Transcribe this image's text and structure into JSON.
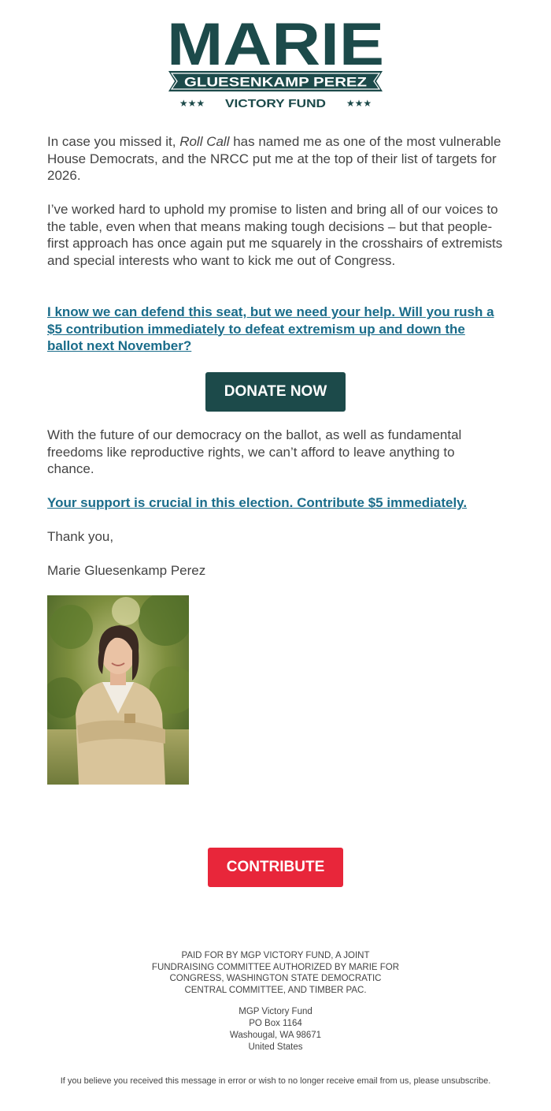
{
  "header": {
    "logo_name": "MARIE",
    "logo_surname": "GLUESENKAMP PEREZ",
    "logo_fund": "VICTORY FUND",
    "logo_stars": "★★★",
    "brand_color": "#1c4a4a"
  },
  "body": {
    "para1_prefix": "In case you missed it, ",
    "para1_italic": "Roll Call",
    "para1_suffix": " has named me as one of the most vulnerable House Democrats, and the NRCC put me at the top of their list of targets for 2026.",
    "para2": "I’ve worked hard to uphold my promise to listen and bring all of our voices to the table, even when that means making tough decisions – but that people-first approach has once again put me squarely in the crosshairs of extremists and special interests who want to kick me out of Congress.",
    "cta_link1": "I know we can defend this seat, but we need your help. Will you rush a $5 contribution immediately to defeat extremism up and down the ballot next November?",
    "donate_button": "DONATE NOW",
    "para3": "With the future of our democracy on the ballot, as well as fundamental freedoms like reproductive rights, we can’t afford to leave anything to chance.",
    "cta_link2": "Your support is crucial in this election. Contribute $5 immediately.",
    "thanks": "Thank you,",
    "signature": "Marie Gluesenkamp Perez",
    "contribute_button": "CONTRIBUTE",
    "link_color": "#1a6c8a",
    "contribute_color": "#e8263a"
  },
  "footer": {
    "disclaimer": "PAID FOR BY MGP VICTORY FUND, A JOINT FUNDRAISING COMMITTEE AUTHORIZED BY MARIE FOR CONGRESS, WASHINGTON STATE DEMOCRATIC CENTRAL COMMITTEE, AND TIMBER PAC.",
    "address_name": "MGP Victory Fund",
    "address_line1": "PO Box 1164",
    "address_line2": "Washougal, WA 98671",
    "address_country": "United States",
    "unsubscribe_text": "If you believe you received this message in error or wish to no longer receive email from us, please unsubscribe."
  }
}
